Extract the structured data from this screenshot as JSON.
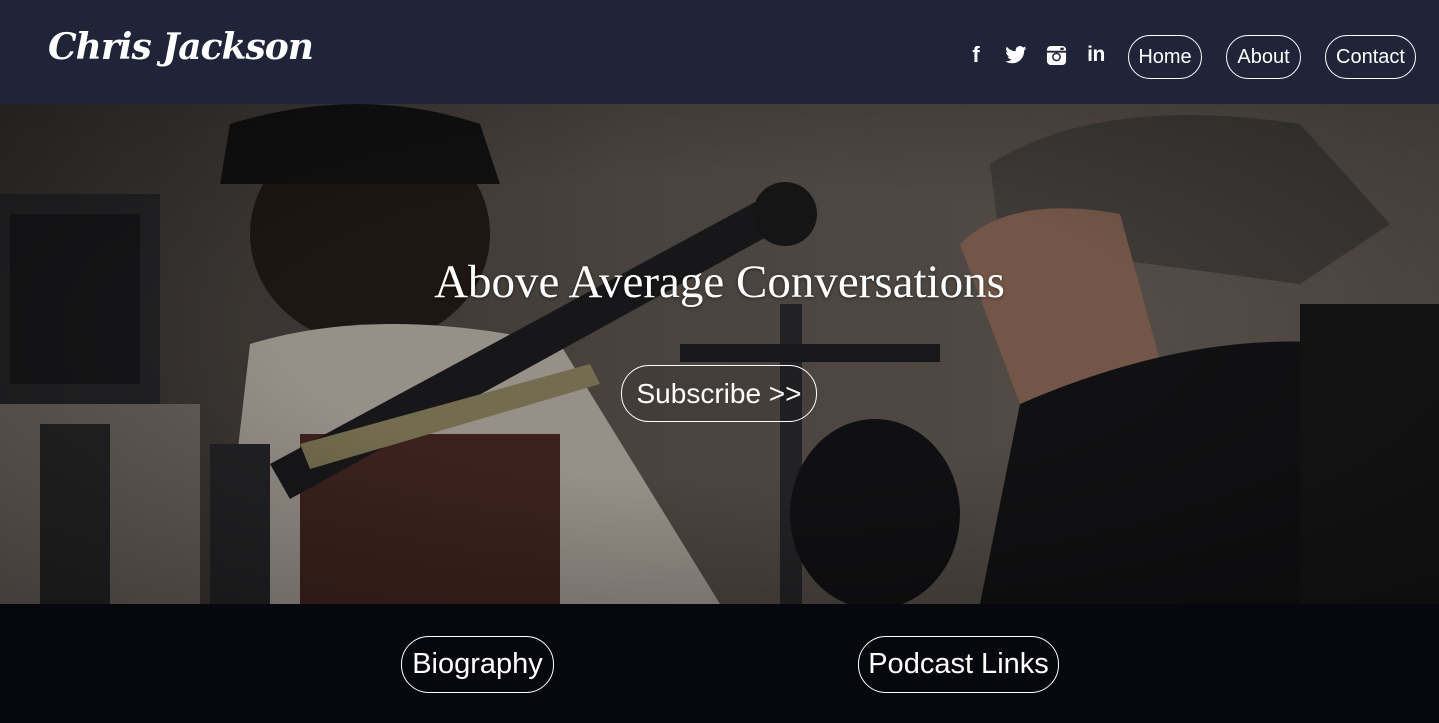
{
  "header": {
    "brand": "Chris Jackson",
    "social": [
      {
        "icon": "facebook-icon",
        "glyph": "f"
      },
      {
        "icon": "twitter-icon"
      },
      {
        "icon": "instagram-icon"
      },
      {
        "icon": "linkedin-icon",
        "glyph": "in"
      }
    ],
    "nav": [
      {
        "label": "Home"
      },
      {
        "label": "About"
      },
      {
        "label": "Contact"
      }
    ]
  },
  "hero": {
    "title": "Above Average Conversations",
    "subscribe_label": "Subscribe >>"
  },
  "footer": {
    "links": [
      {
        "label": "Biography"
      },
      {
        "label": "Podcast Links"
      }
    ]
  },
  "colors": {
    "nav_bg": "#1f2439",
    "footer_bg": "#07080d",
    "text": "#ffffff"
  }
}
